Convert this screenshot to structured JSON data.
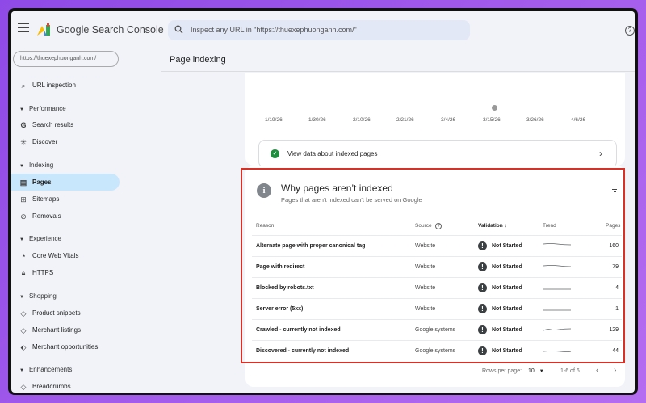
{
  "app": {
    "name": "Google Search Console"
  },
  "search": {
    "placeholder": "Inspect any URL in \"https://thuexephuonganh.com/\""
  },
  "sidebar": {
    "property": "https://thuexephuonganh.com/",
    "url_inspection": "URL inspection",
    "sections": [
      {
        "label": "Performance",
        "items": [
          "Search results",
          "Discover"
        ]
      },
      {
        "label": "Indexing",
        "items": [
          "Pages",
          "Sitemaps",
          "Removals"
        ]
      },
      {
        "label": "Experience",
        "items": [
          "Core Web Vitals",
          "HTTPS"
        ]
      },
      {
        "label": "Shopping",
        "items": [
          "Product snippets",
          "Merchant listings",
          "Merchant opportunities"
        ]
      },
      {
        "label": "Enhancements",
        "items": [
          "Breadcrumbs"
        ]
      }
    ],
    "active_item": "Pages"
  },
  "page": {
    "title": "Page indexing"
  },
  "chart": {
    "x_ticks": [
      "1/19/26",
      "1/30/26",
      "2/10/26",
      "2/21/26",
      "3/4/26",
      "3/15/26",
      "3/26/26",
      "4/6/26"
    ]
  },
  "indexed_link": {
    "label": "View data about indexed pages"
  },
  "why_card": {
    "title": "Why pages aren’t indexed",
    "subtitle": "Pages that aren’t indexed can’t be served on Google",
    "columns": {
      "reason": "Reason",
      "source": "Source",
      "validation": "Validation",
      "trend": "Trend",
      "pages": "Pages"
    },
    "rows": [
      {
        "reason": "Alternate page with proper canonical tag",
        "source": "Website",
        "validation": "Not Started",
        "pages": "160"
      },
      {
        "reason": "Page with redirect",
        "source": "Website",
        "validation": "Not Started",
        "pages": "79"
      },
      {
        "reason": "Blocked by robots.txt",
        "source": "Website",
        "validation": "Not Started",
        "pages": "4"
      },
      {
        "reason": "Server error (5xx)",
        "source": "Website",
        "validation": "Not Started",
        "pages": "1"
      },
      {
        "reason": "Crawled - currently not indexed",
        "source": "Google systems",
        "validation": "Not Started",
        "pages": "129"
      },
      {
        "reason": "Discovered - currently not indexed",
        "source": "Google systems",
        "validation": "Not Started",
        "pages": "44"
      }
    ],
    "pagination": {
      "rows_per_page_label": "Rows per page:",
      "rows_per_page": "10",
      "range": "1-6 of 6"
    }
  },
  "colors": {
    "accent_nav": "#c9e7fc",
    "highlight_border": "#d93025",
    "ok_green": "#1e8e3e"
  }
}
